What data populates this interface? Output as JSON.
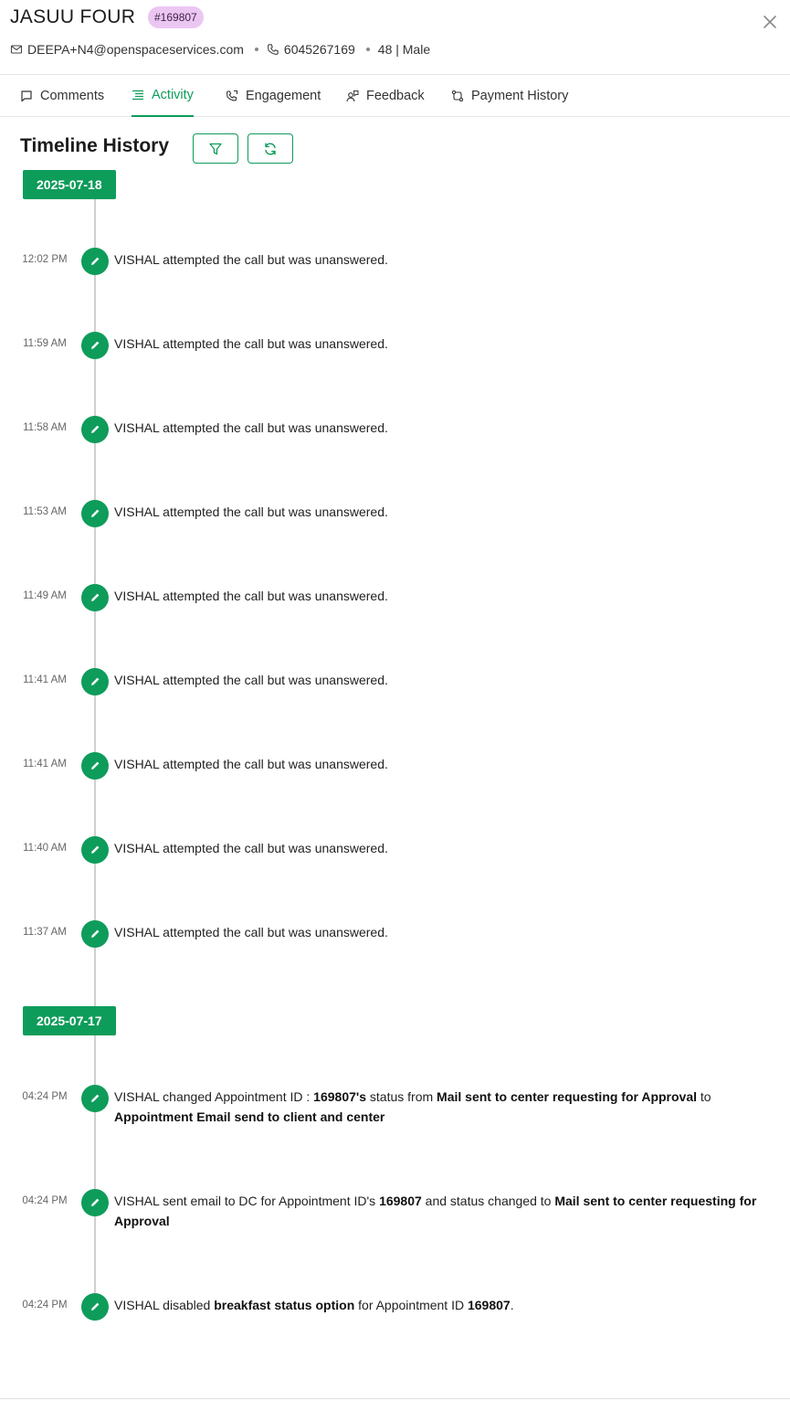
{
  "header": {
    "name": "JASUU FOUR",
    "id_badge": "#169807",
    "email": "DEEPA+N4@openspaceservices.com",
    "phone": "6045267169",
    "age_gender": "48 | Male"
  },
  "tabs": [
    {
      "label": "Comments",
      "icon": "comment-icon"
    },
    {
      "label": "Activity",
      "icon": "list-icon",
      "active": true
    },
    {
      "label": "Engagement",
      "icon": "phone-icon"
    },
    {
      "label": "Feedback",
      "icon": "feedback-icon"
    },
    {
      "label": "Payment History",
      "icon": "payment-icon"
    }
  ],
  "timeline": {
    "title": "Timeline History",
    "groups": [
      {
        "date": "2025-07-18",
        "events": [
          {
            "time": "12:02 PM",
            "text": "VISHAL attempted the call but was unanswered."
          },
          {
            "time": "11:59 AM",
            "text": "VISHAL attempted the call but was unanswered."
          },
          {
            "time": "11:58 AM",
            "text": "VISHAL attempted the call but was unanswered."
          },
          {
            "time": "11:53 AM",
            "text": "VISHAL attempted the call but was unanswered."
          },
          {
            "time": "11:49 AM",
            "text": "VISHAL attempted the call but was unanswered."
          },
          {
            "time": "11:41 AM",
            "text": "VISHAL attempted the call but was unanswered."
          },
          {
            "time": "11:41 AM",
            "text": "VISHAL attempted the call but was unanswered."
          },
          {
            "time": "11:40 AM",
            "text": "VISHAL attempted the call but was unanswered."
          },
          {
            "time": "11:37 AM",
            "text": "VISHAL attempted the call but was unanswered."
          }
        ]
      },
      {
        "date": "2025-07-17",
        "events": [
          {
            "time": "04:24 PM",
            "parts": [
              {
                "t": "VISHAL changed Appointment ID : "
              },
              {
                "t": "169807's",
                "b": true
              },
              {
                "t": " status from "
              },
              {
                "t": "Mail sent to center requesting for Approval",
                "b": true
              },
              {
                "t": " to "
              },
              {
                "t": "Appointment Email send to client and center",
                "b": true
              }
            ]
          },
          {
            "time": "04:24 PM",
            "parts": [
              {
                "t": "VISHAL sent email to DC for Appointment ID's "
              },
              {
                "t": "169807",
                "b": true
              },
              {
                "t": " and status changed to "
              },
              {
                "t": "Mail sent to center requesting for Approval",
                "b": true
              }
            ]
          },
          {
            "time": "04:24 PM",
            "parts": [
              {
                "t": "VISHAL disabled "
              },
              {
                "t": "breakfast status option",
                "b": true
              },
              {
                "t": " for Appointment ID "
              },
              {
                "t": "169807",
                "b": true
              },
              {
                "t": "."
              }
            ]
          }
        ]
      }
    ]
  }
}
